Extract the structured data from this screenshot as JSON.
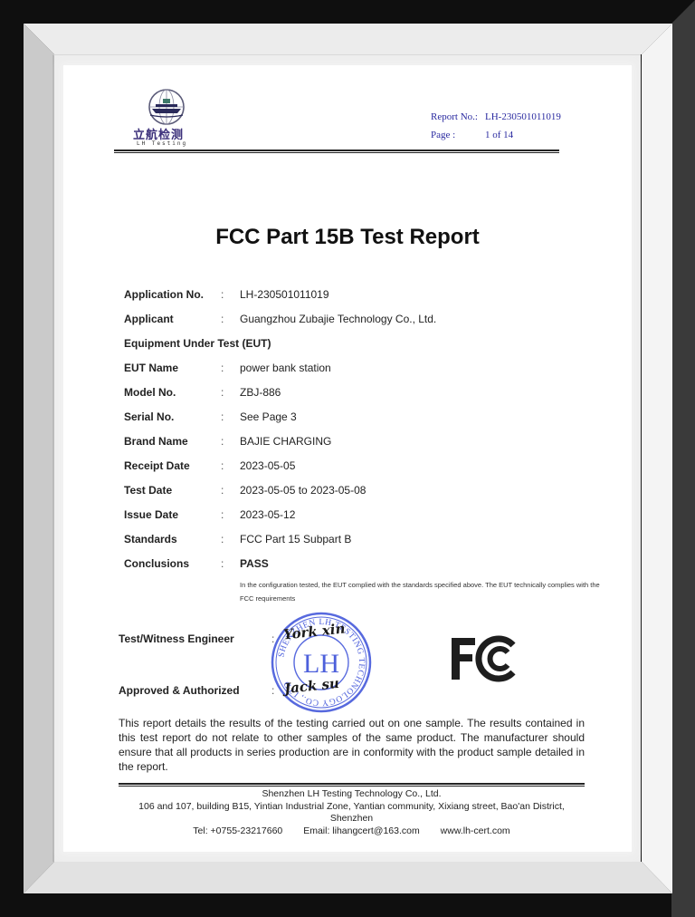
{
  "header": {
    "logo_cn": "立航检测",
    "logo_en": "LH Testing",
    "report_no_label": "Report No.:",
    "report_no": "LH-230501011019",
    "page_label": "Page :",
    "page_value": "1 of 14"
  },
  "title": "FCC Part 15B Test Report",
  "fields": [
    {
      "label": "Application No.",
      "colon": ":",
      "value": "LH-230501011019"
    },
    {
      "label": "Applicant",
      "colon": ":",
      "value": "Guangzhou Zubajie Technology Co., Ltd."
    },
    {
      "label": "Equipment Under Test (EUT)",
      "colon": "",
      "value": ""
    },
    {
      "label": "EUT Name",
      "colon": ":",
      "value": "power bank station"
    },
    {
      "label": "Model No.",
      "colon": ":",
      "value": "ZBJ-886"
    },
    {
      "label": "Serial No.",
      "colon": ":",
      "value": "See Page 3"
    },
    {
      "label": "Brand Name",
      "colon": ":",
      "value": "BAJIE CHARGING"
    },
    {
      "label": "Receipt Date",
      "colon": ":",
      "value": "2023-05-05"
    },
    {
      "label": "Test Date",
      "colon": ":",
      "value": "2023-05-05 to 2023-05-08"
    },
    {
      "label": "Issue Date",
      "colon": ":",
      "value": "2023-05-12"
    },
    {
      "label": "Standards",
      "colon": ":",
      "value": "FCC Part 15 Subpart B"
    },
    {
      "label": "Conclusions",
      "colon": ":",
      "value": "PASS"
    }
  ],
  "conclusion_note": "In the configuration tested, the EUT complied with the standards specified above. The EUT technically complies with the FCC requirements",
  "signatures": {
    "engineer_label": "Test/Witness Engineer",
    "engineer_name": "York xin",
    "approver_label": "Approved & Authorized",
    "approver_name": "Jack su",
    "colon": ":"
  },
  "stamp": {
    "ring_text": "SHENZHEN LH TESTING TECHNOLOGY CO., LTD",
    "center_text": "LH",
    "color": "#3a4fd8"
  },
  "fcc_logo": {
    "icon": "fcc-logo-icon"
  },
  "disclaimer": "This report details the results of the testing carried out on one sample. The results contained in this test report do not relate to other samples of the same product. The manufacturer should ensure that all products in series production are in conformity with the product sample detailed in the report.",
  "footer": {
    "company": "Shenzhen LH Testing Technology Co., Ltd.",
    "address": "106 and 107, building B15, Yintian Industrial Zone, Yantian community, Xixiang street, Bao'an District, Shenzhen",
    "tel": "Tel: +0755-23217660",
    "email": "Email: lihangcert@163.com",
    "website": "www.lh-cert.com"
  }
}
